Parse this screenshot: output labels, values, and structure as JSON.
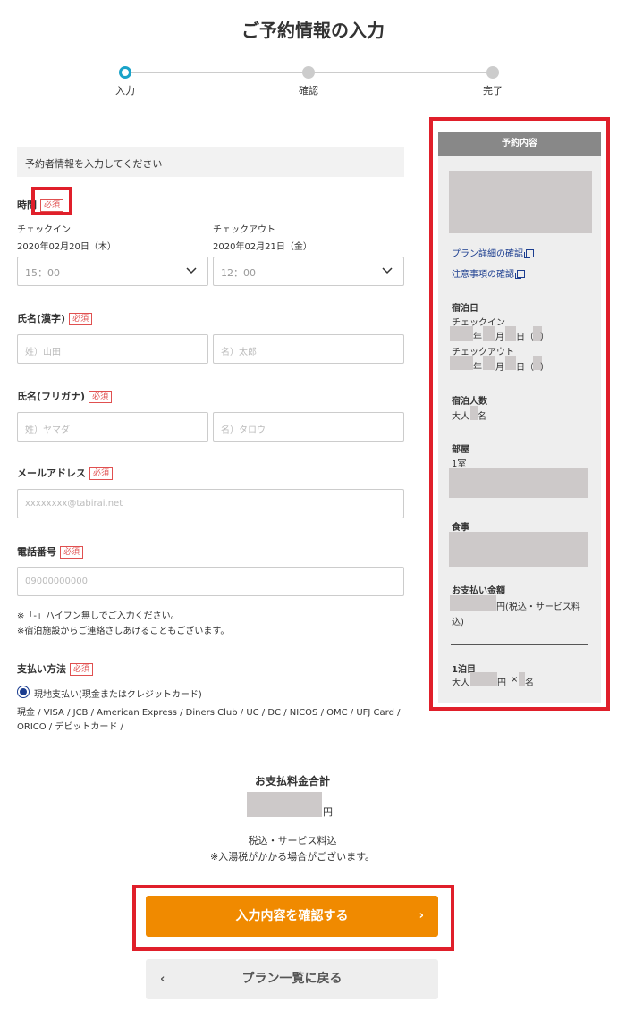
{
  "page": {
    "title": "ご予約情報の入力"
  },
  "stepper": {
    "steps": [
      {
        "label": "入力",
        "state": "active"
      },
      {
        "label": "確認",
        "state": "inactive"
      },
      {
        "label": "完了",
        "state": "inactive"
      }
    ],
    "active_color": "#1aa3c9"
  },
  "form": {
    "header": "予約者情報を入力してください",
    "required_badge": "必須",
    "time": {
      "label": "時間",
      "checkin_label": "チェックイン",
      "checkin_date": "2020年02月20日（木）",
      "checkin_time": "15：00",
      "checkout_label": "チェックアウト",
      "checkout_date": "2020年02月21日（金）",
      "checkout_time": "12：00"
    },
    "name_kanji": {
      "label": "氏名(漢字)",
      "last_placeholder": "姓）山田",
      "first_placeholder": "名）太郎"
    },
    "name_kana": {
      "label": "氏名(フリガナ)",
      "last_placeholder": "姓）ヤマダ",
      "first_placeholder": "名）タロウ"
    },
    "email": {
      "label": "メールアドレス",
      "placeholder": "xxxxxxxx@tabirai.net"
    },
    "phone": {
      "label": "電話番号",
      "placeholder": "09000000000",
      "note1": "※「-」ハイフン無しでご入力ください。",
      "note2": "※宿泊施設からご連絡さしあげることもございます。"
    },
    "payment": {
      "label": "支払い方法",
      "option": "現地支払い(現金またはクレジットカード)",
      "cards": "現金 / VISA / JCB / American Express / Diners Club / UC / DC / NICOS / OMC / UFJ Card / ORICO / デビットカード /"
    }
  },
  "summary": {
    "total_label": "お支払料金合計",
    "unit": "円",
    "tax_note": "税込・サービス料込",
    "bath_tax_note": "※入湯税がかかる場合がございます。"
  },
  "buttons": {
    "confirm": "入力内容を確認する",
    "back": "プラン一覧に戻る"
  },
  "sidebar": {
    "title": "予約内容",
    "plan_link": "プラン詳細の確認",
    "notes_link": "注意事項の確認",
    "stay_label": "宿泊日",
    "checkin": "チェックイン",
    "checkout": "チェックアウト",
    "year": "年",
    "month": "月",
    "day": "日",
    "paren_open": "（",
    "paren_close": "）",
    "guests_label": "宿泊人数",
    "adult": "大人",
    "person_unit": "名",
    "room_label": "部屋",
    "room_count": "1室",
    "meal_label": "食事",
    "payment_label": "お支払い金額",
    "payment_unit_note": "円(税込・サービス料",
    "payment_unit_note2": "込)",
    "night_label": "1泊目",
    "yen": "円",
    "times": "×"
  },
  "colors": {
    "accent_orange": "#f08a00",
    "link_blue": "#1a3c8f",
    "required_red": "#e05050",
    "highlight_red": "#e01f2a"
  },
  "icons": [
    "chevron-down-icon",
    "external-link-icon",
    "chevron-right-icon",
    "chevron-left-icon",
    "radio-selected-icon"
  ]
}
